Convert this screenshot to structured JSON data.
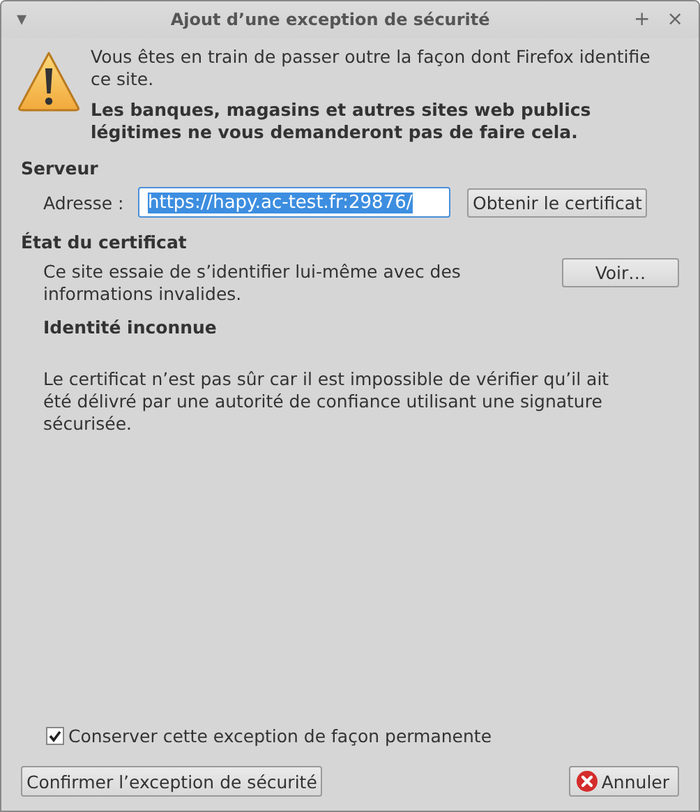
{
  "window": {
    "title": "Ajout d’une exception de sécurité",
    "menu_glyph": "▾",
    "controls": [
      "+",
      "×"
    ]
  },
  "warning": {
    "text": "Vous êtes en train de passer outre la façon dont Firefox identifie ce site.",
    "bold_text": "Les banques, magasins et autres sites web publics légitimes ne vous demanderont pas de faire cela."
  },
  "server": {
    "heading": "Serveur",
    "address_label": "Adresse :",
    "address_value": "https://hapy.ac-test.fr:29876/",
    "get_button": "Obtenir le certificat"
  },
  "certificate": {
    "heading": "État du certificat",
    "summary": "Ce site essaie de s’identifier lui-même avec des informations invalides.",
    "view_button": "Voir…",
    "problem_title": "Identité inconnue",
    "problem_text": "Le certificat n’est pas sûr car il est impossible de vérifier qu’il ait été délivré par une autorité de confiance utilisant une signature sécurisée."
  },
  "permanent": {
    "label": "Conserver cette exception de façon permanente",
    "checked": true
  },
  "buttons": {
    "confirm": "Confirmer l’exception de sécurité",
    "cancel": "Annuler"
  }
}
